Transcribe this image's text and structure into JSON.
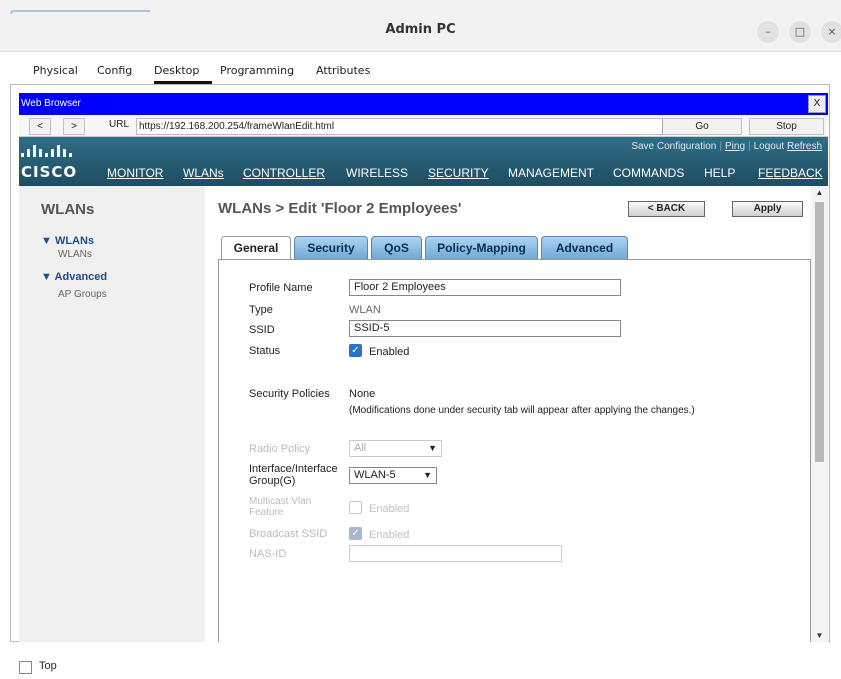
{
  "window": {
    "title": "Admin PC"
  },
  "window_controls": {
    "minimize": "–",
    "maximize": "□",
    "close": "×"
  },
  "pt_tabs": [
    "Physical",
    "Config",
    "Desktop",
    "Programming",
    "Attributes"
  ],
  "pt_active_tab": "Desktop",
  "browser": {
    "title": "Web Browser",
    "close": "X",
    "back": "<",
    "forward": ">",
    "url_label": "URL",
    "url": "https://192.168.200.254/frameWlanEdit.html",
    "go": "Go",
    "stop": "Stop"
  },
  "cisco": {
    "logo": "CISCO",
    "top_links": [
      "Save Configuration",
      "Ping",
      "Logout",
      "Refresh"
    ],
    "menu": [
      "MONITOR",
      "WLANs",
      "CONTROLLER",
      "WIRELESS",
      "SECURITY",
      "MANAGEMENT",
      "COMMANDS",
      "HELP",
      "FEEDBACK"
    ],
    "brand_color": "#2a6680"
  },
  "sidebar": {
    "title": "WLANs",
    "groups": [
      {
        "label": "WLANs",
        "sub": "WLANs"
      },
      {
        "label": "Advanced",
        "sub": "AP Groups"
      }
    ]
  },
  "page": {
    "title": "WLANs > Edit  'Floor 2 Employees'",
    "back_button": "< BACK",
    "apply_button": "Apply"
  },
  "tabs": [
    "General",
    "Security",
    "QoS",
    "Policy-Mapping",
    "Advanced"
  ],
  "active_tab": "General",
  "form": {
    "profile_name": {
      "label": "Profile Name",
      "value": "Floor 2 Employees"
    },
    "type": {
      "label": "Type",
      "value": "WLAN"
    },
    "ssid": {
      "label": "SSID",
      "value": "SSID-5"
    },
    "status": {
      "label": "Status",
      "checkbox_label": "Enabled",
      "checked": true
    },
    "security_policies": {
      "label": "Security Policies",
      "value": "None",
      "note": "(Modifications done under security tab will appear after applying the changes.)"
    },
    "radio_policy": {
      "label": "Radio Policy",
      "value": "All"
    },
    "interface": {
      "label": "Interface/Interface Group(G)",
      "value": "WLAN-5"
    },
    "multicast_vlan": {
      "label": "Multicast Vlan Feature",
      "checkbox_label": "Enabled",
      "checked": false
    },
    "broadcast_ssid": {
      "label": "Broadcast SSID",
      "checkbox_label": "Enabled",
      "checked": true
    },
    "nas_id": {
      "label": "NAS-ID",
      "value": ""
    }
  },
  "bottom": {
    "top_label": "Top"
  }
}
